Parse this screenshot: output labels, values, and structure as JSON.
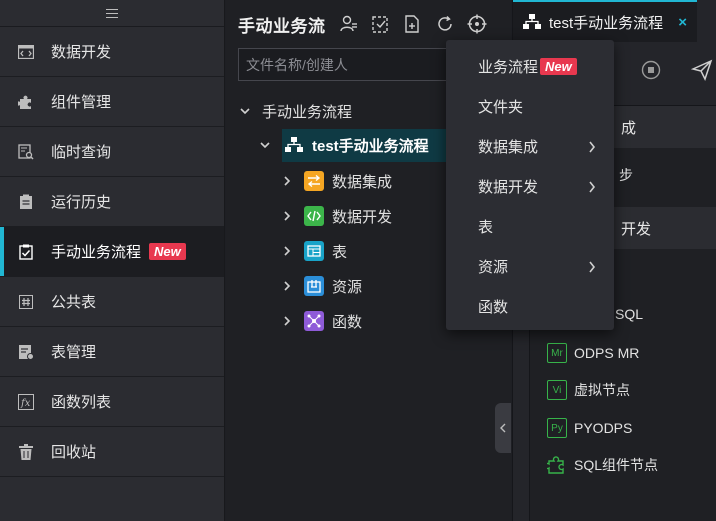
{
  "sidebar": {
    "items": [
      {
        "label": "数据开发",
        "icon": "code-icon"
      },
      {
        "label": "组件管理",
        "icon": "puzzle-icon"
      },
      {
        "label": "临时查询",
        "icon": "query-icon"
      },
      {
        "label": "运行历史",
        "icon": "clipboard-icon"
      },
      {
        "label": "手动业务流程",
        "icon": "clipboard-check-icon",
        "badge": "New",
        "active": true
      },
      {
        "label": "公共表",
        "icon": "hash-icon"
      },
      {
        "label": "表管理",
        "icon": "table-manage-icon"
      },
      {
        "label": "函数列表",
        "icon": "function-icon"
      },
      {
        "label": "回收站",
        "icon": "trash-icon"
      }
    ]
  },
  "tree_panel": {
    "title": "手动业务流",
    "search_placeholder": "文件名称/创建人",
    "root_label": "手动业务流程",
    "workflow_label": "test手动业务流程",
    "children": [
      {
        "label": "数据集成",
        "icon": "arrows-icon",
        "color": "#f5a623"
      },
      {
        "label": "数据开发",
        "icon": "code-tag-icon",
        "color": "#3cb54a"
      },
      {
        "label": "表",
        "icon": "table-icon",
        "color": "#19a3c8"
      },
      {
        "label": "资源",
        "icon": "resource-icon",
        "color": "#2b8ed8"
      },
      {
        "label": "函数",
        "icon": "function-node-icon",
        "color": "#8e5bd8"
      }
    ]
  },
  "menu": {
    "items": [
      {
        "label": "业务流程",
        "badge": "New",
        "submenu": false
      },
      {
        "label": "文件夹",
        "submenu": false
      },
      {
        "label": "数据集成",
        "submenu": true
      },
      {
        "label": "数据开发",
        "submenu": true
      },
      {
        "label": "表",
        "submenu": false
      },
      {
        "label": "资源",
        "submenu": true
      },
      {
        "label": "函数",
        "submenu": false
      }
    ]
  },
  "right_panel": {
    "tab_label": "test手动业务流程",
    "close_symbol": "×",
    "section1_partial": "成",
    "section1_item_partial": "步",
    "section2_partial": "开发",
    "partial_sql": "SQL",
    "components": [
      {
        "badge": "Mr",
        "label": "ODPS MR"
      },
      {
        "badge": "Vi",
        "label": "虚拟节点"
      },
      {
        "badge": "Py",
        "label": "PYODPS"
      },
      {
        "badge": "",
        "label": "SQL组件节点"
      }
    ]
  },
  "colors": {
    "accent": "#21b7d3",
    "new_badge": "#e8384f",
    "green": "#37b34a"
  }
}
